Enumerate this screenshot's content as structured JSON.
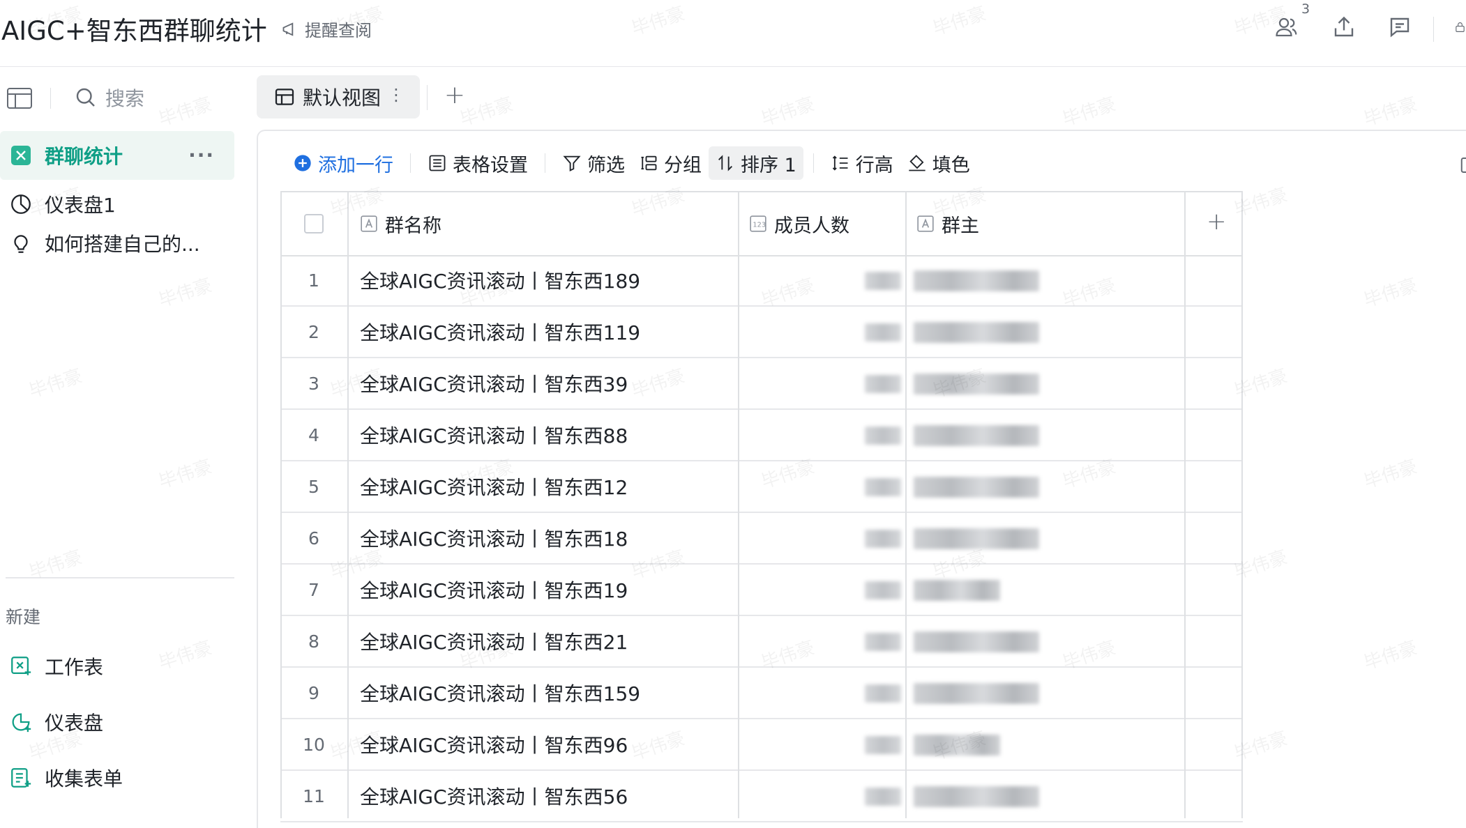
{
  "header": {
    "title": "AIGC+智东西群聊统计",
    "remind_label": "提醒查阅",
    "collaborator_count": "3"
  },
  "sidebar": {
    "search_placeholder": "搜索",
    "items": [
      {
        "label": "群聊统计",
        "icon": "table-icon",
        "active": true
      },
      {
        "label": "仪表盘1",
        "icon": "dashboard-icon"
      },
      {
        "label": "如何搭建自己的...",
        "icon": "lightbulb-icon"
      }
    ],
    "new_section_label": "新建",
    "new_items": [
      {
        "label": "工作表",
        "icon": "new-sheet-icon"
      },
      {
        "label": "仪表盘",
        "icon": "new-dashboard-icon"
      },
      {
        "label": "收集表单",
        "icon": "new-form-icon"
      }
    ]
  },
  "view": {
    "tab_label": "默认视图"
  },
  "toolbar": {
    "add_row": "添加一行",
    "table_settings": "表格设置",
    "filter": "筛选",
    "group": "分组",
    "sort": "排序 1",
    "row_height": "行高",
    "fill_color": "填色"
  },
  "table": {
    "columns": [
      {
        "label": "群名称",
        "type": "text"
      },
      {
        "label": "成员人数",
        "type": "number"
      },
      {
        "label": "群主",
        "type": "text"
      }
    ],
    "rows": [
      {
        "index": "1",
        "name": "全球AIGC资讯滚动丨智东西189"
      },
      {
        "index": "2",
        "name": "全球AIGC资讯滚动丨智东西119"
      },
      {
        "index": "3",
        "name": "全球AIGC资讯滚动丨智东西39"
      },
      {
        "index": "4",
        "name": "全球AIGC资讯滚动丨智东西88"
      },
      {
        "index": "5",
        "name": "全球AIGC资讯滚动丨智东西12"
      },
      {
        "index": "6",
        "name": "全球AIGC资讯滚动丨智东西18"
      },
      {
        "index": "7",
        "name": "全球AIGC资讯滚动丨智东西19"
      },
      {
        "index": "8",
        "name": "全球AIGC资讯滚动丨智东西21"
      },
      {
        "index": "9",
        "name": "全球AIGC资讯滚动丨智东西159"
      },
      {
        "index": "10",
        "name": "全球AIGC资讯滚动丨智东西96"
      },
      {
        "index": "11",
        "name": "全球AIGC资讯滚动丨智东西56"
      }
    ]
  },
  "watermark": "毕伟豪",
  "colors": {
    "accent": "#0f9f86",
    "primary": "#1f6fe0",
    "text": "#1f2329",
    "muted": "#646a73"
  }
}
